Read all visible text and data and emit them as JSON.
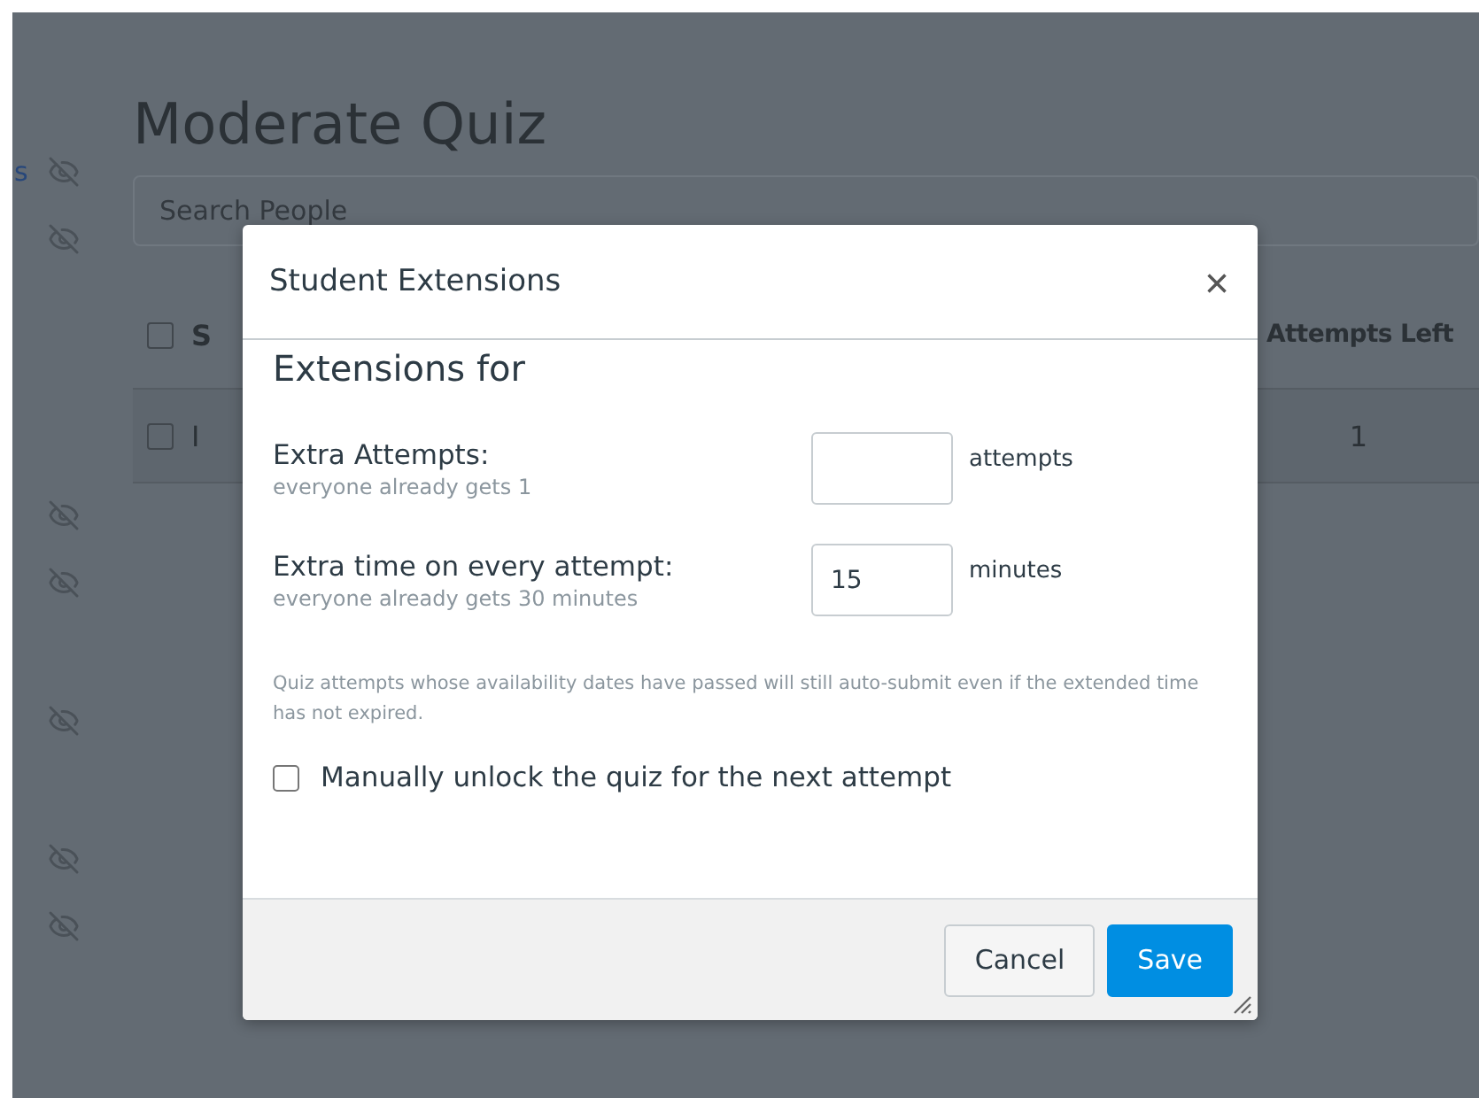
{
  "background": {
    "left_link_fragment": "s",
    "title": "Moderate Quiz",
    "search": {
      "placeholder": "Search People"
    },
    "table": {
      "header_checkbox": {
        "checked": false
      },
      "columns": [
        {
          "label": "S"
        },
        {
          "label": "Attempts Left"
        }
      ],
      "rows": [
        {
          "checked": false,
          "cells": [
            "I",
            "1"
          ]
        }
      ]
    }
  },
  "dialog": {
    "title": "Student Extensions",
    "close": "×",
    "heading": "Extensions for",
    "fields": [
      {
        "label": "Extra Attempts:",
        "hint": "everyone already gets 1",
        "unit": "attempts"
      },
      {
        "label": "Extra time on every attempt:",
        "hint": "everyone already gets 30 minutes",
        "value": "15",
        "unit": "minutes"
      }
    ],
    "note": "Quiz attempts whose availability dates have passed will still auto-submit even if the extended time has not expired.",
    "unlock": {
      "label": "Manually unlock the quiz for the next attempt",
      "checked": false
    },
    "buttons": [
      {
        "label": "Cancel",
        "kind": "secondary"
      },
      {
        "label": "Save",
        "kind": "primary"
      }
    ]
  }
}
